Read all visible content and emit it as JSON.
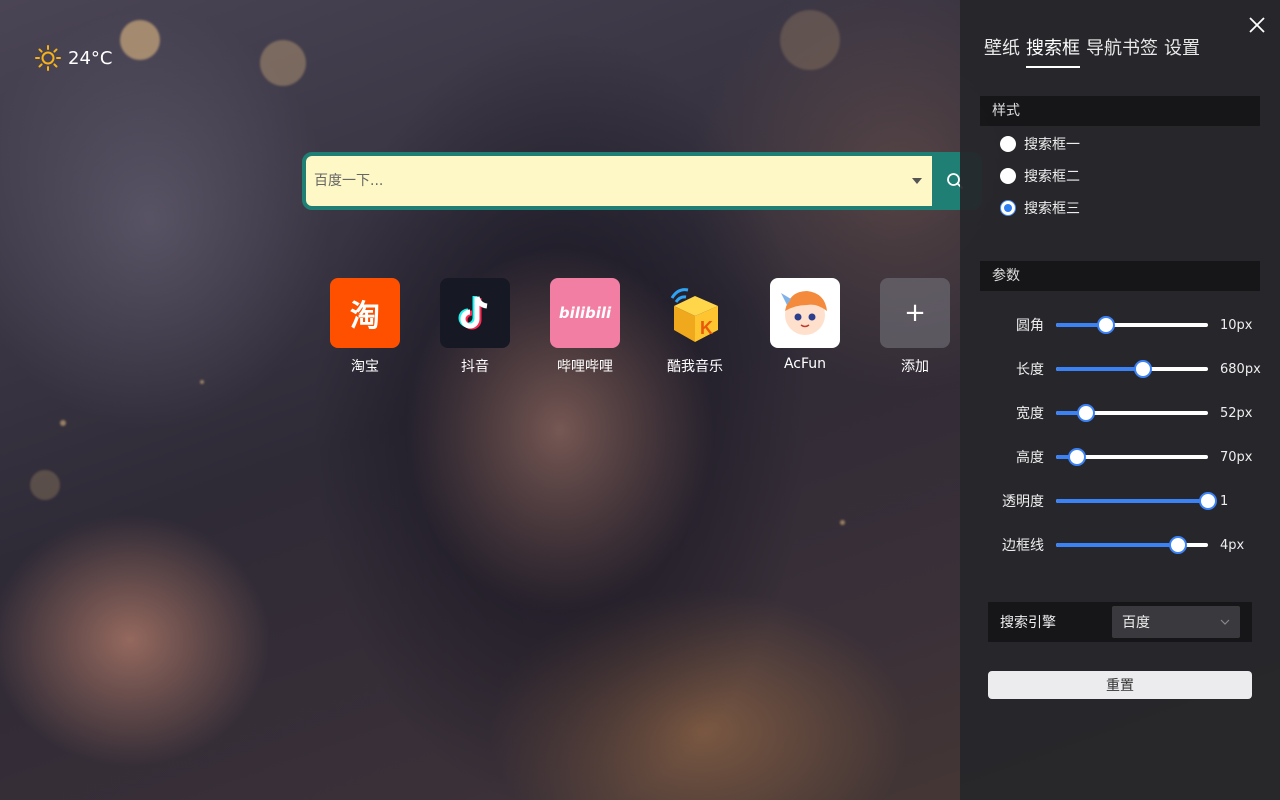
{
  "weather": {
    "temperature": "24°C",
    "icon": "sun-icon"
  },
  "search": {
    "placeholder": "百度一下...",
    "icon": "search-icon"
  },
  "bookmarks": [
    {
      "label": "淘宝",
      "icon_text": "淘"
    },
    {
      "label": "抖音",
      "icon": "douyin-icon"
    },
    {
      "label": "哔哩哔哩",
      "icon_text": "bilibili"
    },
    {
      "label": "酷我音乐",
      "icon_text": "K"
    },
    {
      "label": "AcFun",
      "icon": "acfun-mascot-icon"
    },
    {
      "label": "添加",
      "icon_text": "+"
    }
  ],
  "panel": {
    "tabs": [
      "壁纸",
      "搜索框",
      "导航书签",
      "设置"
    ],
    "active_tab": 1,
    "style_section": {
      "title": "样式",
      "options": [
        "搜索框一",
        "搜索框二",
        "搜索框三"
      ],
      "selected": 2
    },
    "params_section": {
      "title": "参数",
      "sliders": [
        {
          "label": "圆角",
          "value": "10px",
          "fraction": 0.33
        },
        {
          "label": "长度",
          "value": "680px",
          "fraction": 0.57
        },
        {
          "label": "宽度",
          "value": "52px",
          "fraction": 0.2
        },
        {
          "label": "高度",
          "value": "70px",
          "fraction": 0.14
        },
        {
          "label": "透明度",
          "value": "1",
          "fraction": 1.0
        },
        {
          "label": "边框线",
          "value": "4px",
          "fraction": 0.8
        }
      ]
    },
    "engine": {
      "label": "搜索引擎",
      "value": "百度"
    },
    "reset_label": "重置"
  },
  "colors": {
    "accent": "#1f7f74",
    "search_bg": "#fdf8c6",
    "slider": "#3b82f6",
    "panel_bg": "#26262a"
  }
}
